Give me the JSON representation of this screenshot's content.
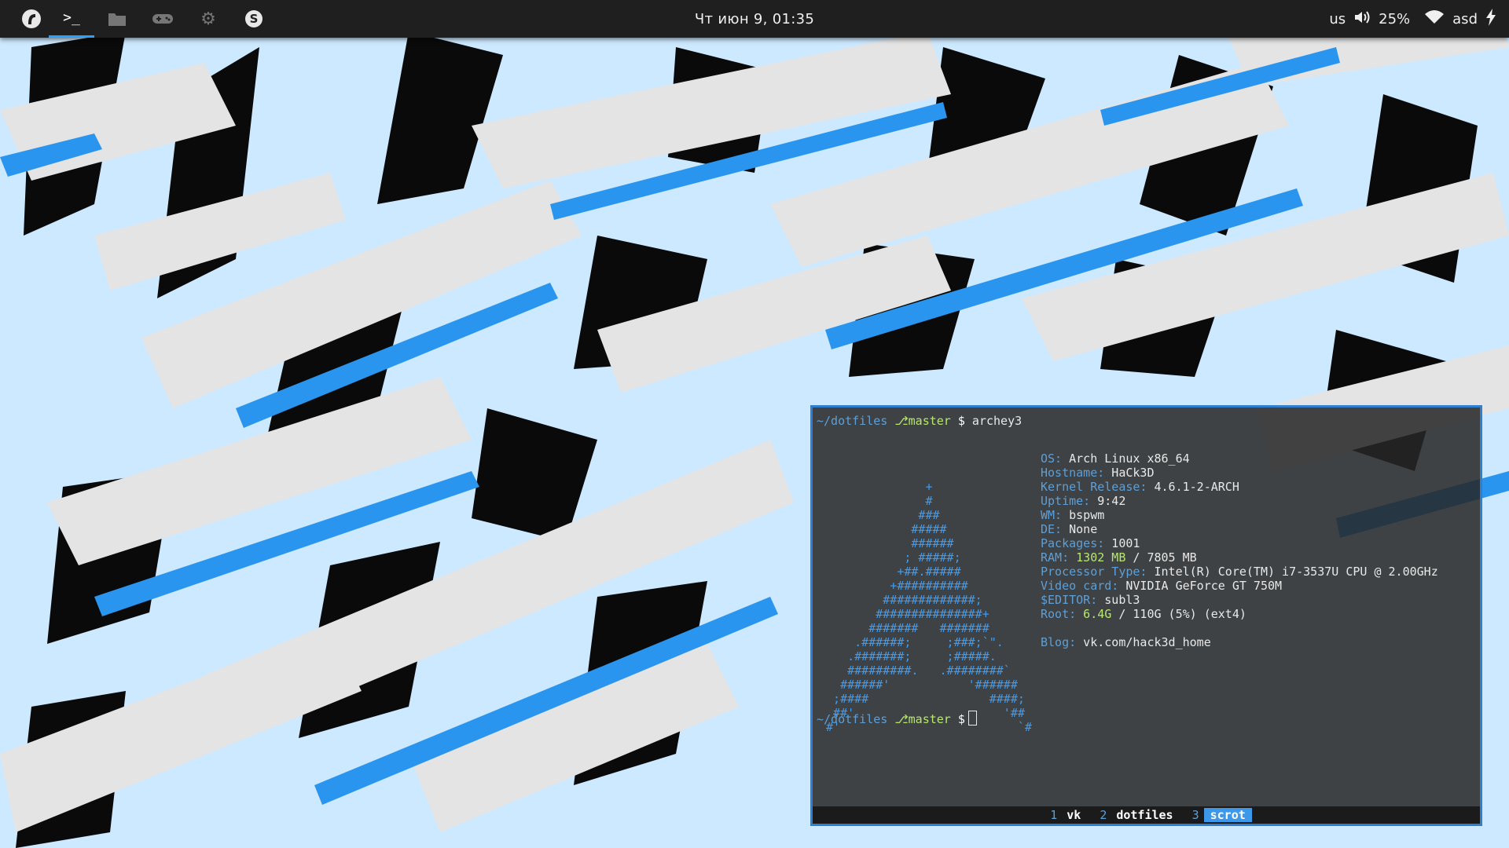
{
  "topbar": {
    "launcher_icon": "fedora-like-logo-icon",
    "apps": [
      {
        "name": "terminal-icon",
        "glyph": ">_",
        "active": true
      },
      {
        "name": "folder-icon",
        "active": false
      },
      {
        "name": "gamepad-icon",
        "active": false
      },
      {
        "name": "gear-icon",
        "active": false
      },
      {
        "name": "skype-icon",
        "active": false
      }
    ],
    "clock": "Чт июн  9, 01:35",
    "keyboard_layout": "us",
    "volume": "25%",
    "wifi_name": "asd"
  },
  "terminal": {
    "prompt_path": "~/dotfiles",
    "prompt_branch": "⎇master",
    "prompt_symbol": "$",
    "command": "archey3",
    "logo_lines": [
      "               +",
      "               #",
      "              ###",
      "             #####",
      "             ######",
      "            ; #####;",
      "           +##.#####",
      "          +##########",
      "         #############;",
      "        ###############+",
      "       #######   #######",
      "     .######;     ;###;`\".",
      "    .#######;     ;#####.",
      "    #########.   .########`",
      "   ######'           '######",
      "  ;####                 ####;",
      "  ##'                     '##",
      " #'                         `#"
    ],
    "info": [
      {
        "key": "OS:",
        "value": " Arch Linux x86_64"
      },
      {
        "key": "Hostname:",
        "value": " HaCk3D"
      },
      {
        "key": "Kernel Release:",
        "value": " 4.6.1-2-ARCH"
      },
      {
        "key": "Uptime:",
        "value": " 9:42"
      },
      {
        "key": "WM:",
        "value": " bspwm"
      },
      {
        "key": "DE:",
        "value": " None"
      },
      {
        "key": "Packages:",
        "value": " 1001"
      },
      {
        "key": "RAM:",
        "value_hl": " 1302 MB",
        "value": " / 7805 MB"
      },
      {
        "key": "Processor Type:",
        "value": " Intel(R) Core(TM) i7-3537U CPU @ 2.00GHz"
      },
      {
        "key": "Video card:",
        "value": " NVIDIA GeForce GT 750M"
      },
      {
        "key": "$EDITOR:",
        "value": " subl3"
      },
      {
        "key": "Root:",
        "value_hl": " 6.4G",
        "value": " / 110G (5%) (ext4)"
      },
      {
        "key": "",
        "value": ""
      },
      {
        "key": "Blog:",
        "value": " vk.com/hack3d_home"
      }
    ],
    "workspaces": [
      {
        "num": "1",
        "name": "vk",
        "active": false
      },
      {
        "num": "2",
        "name": "dotfiles",
        "active": false
      },
      {
        "num": "3",
        "name": "scrot",
        "active": true
      }
    ]
  }
}
